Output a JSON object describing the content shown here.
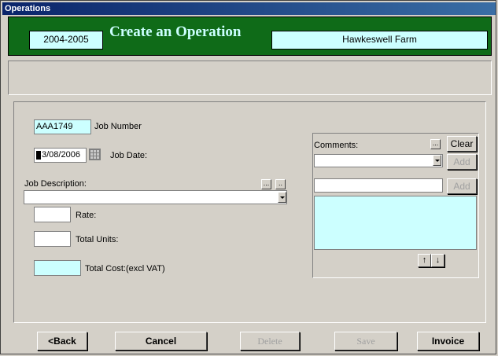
{
  "window": {
    "title": "Operations"
  },
  "header": {
    "year": "2004-2005",
    "title": "Create an Operation",
    "farm": "Hawkeswell Farm"
  },
  "job": {
    "number_value": "AAA1749",
    "number_label": "Job Number",
    "date_value": "3/08/2006",
    "date_label": "Job Date:",
    "description_label": "Job Description:",
    "description_value": "",
    "rate_label": "Rate:",
    "rate_value": "",
    "units_label": "Total Units:",
    "units_value": "",
    "cost_label": "Total Cost:(excl VAT)",
    "cost_value": ""
  },
  "comments": {
    "label": "Comments:",
    "browse_label": "...",
    "clear_label": "Clear",
    "add_label": "Add",
    "add2_label": "Add",
    "up_label": "↑",
    "down_label": "↓"
  },
  "desc_buttons": {
    "browse1": "...",
    "browse2": ".."
  },
  "footer": {
    "back": "<Back",
    "cancel": "Cancel",
    "delete": "Delete",
    "save": "Save",
    "invoice": "Invoice"
  },
  "colors": {
    "header_bg": "#0f6b18",
    "field_bg": "#ccffff",
    "title_bar": "#0a246a"
  }
}
